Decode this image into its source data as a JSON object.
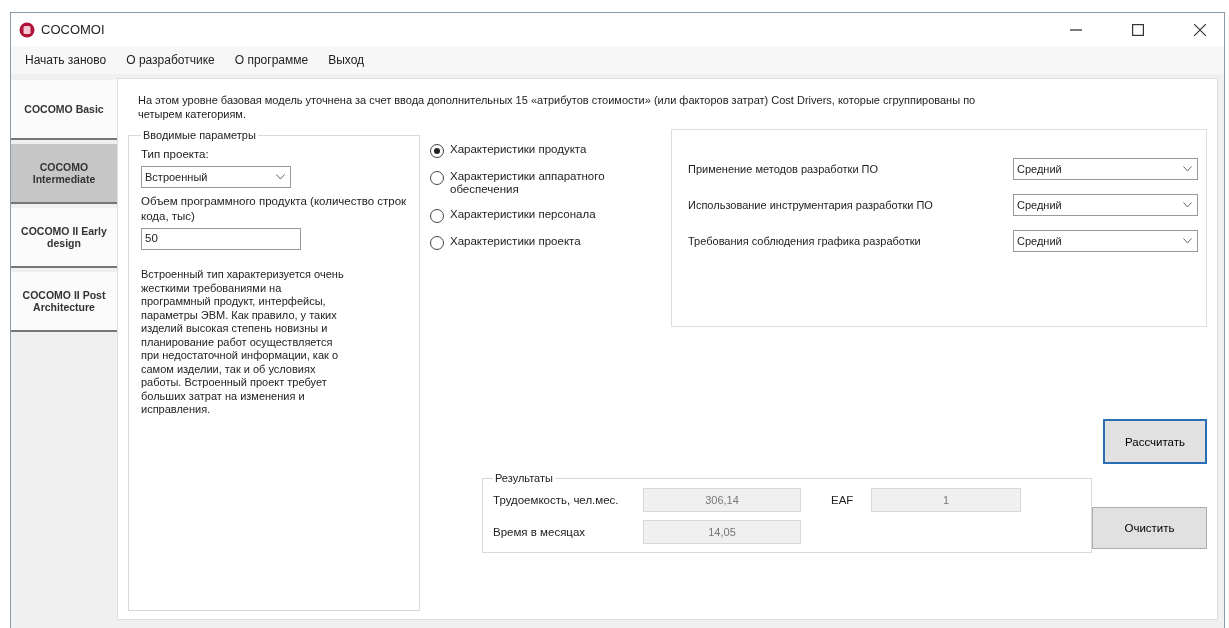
{
  "window": {
    "title": "COCOMOI"
  },
  "menu": [
    "Начать заново",
    "О разработчике",
    "О программе",
    "Выход"
  ],
  "tabs": [
    {
      "label": "COCOMO Basic",
      "selected": false
    },
    {
      "label": "COCOMO Intermediate",
      "selected": true
    },
    {
      "label": "COCOMO II Early design",
      "selected": false
    },
    {
      "label": "COCOMO II Post Architecture",
      "selected": false
    }
  ],
  "description": "На этом уровне базовая модель уточнена за счет ввода дополнительных 15 «атрибутов стоимости» (или факторов затрат) Cost Drivers, которые сгруппированы по четырем категориям.",
  "input_group": {
    "title": "Вводимые параметры",
    "project_type_label": "Тип проекта:",
    "project_type": "Встроенный",
    "size_label": "Объем программного продукта (количество строк кода, тыс)",
    "size": "50",
    "type_description": "Встроенный тип характеризуется очень жесткими требованиями на программный продукт, интерфейсы, параметры ЭВМ. Как правило, у таких изделий высокая степень новизны и планирование работ осуществляется при недостаточной информации, как о самом изделии, так и об условиях работы. Встроенный проект требует больших затрат на изменения и исправления."
  },
  "categories": [
    {
      "label": "Характеристики продукта",
      "selected": true
    },
    {
      "label": "Характеристики аппаратного обеспечения",
      "selected": false
    },
    {
      "label": "Характеристики персонала",
      "selected": false
    },
    {
      "label": "Характеристики проекта",
      "selected": false
    }
  ],
  "attributes": [
    {
      "label": "Применение методов разработки ПО",
      "value": "Средний"
    },
    {
      "label": "Использование инструментария разработки ПО",
      "value": "Средний"
    },
    {
      "label": "Требования соблюдения графика разработки",
      "value": "Средний"
    }
  ],
  "calculate_button": "Рассчитать",
  "results": {
    "title": "Результаты",
    "effort_label": "Трудоемкость, чел.мес.",
    "effort": "306,14",
    "eaf_label": "EAF",
    "eaf": "1",
    "time_label": "Время в месяцах",
    "time": "14,05"
  },
  "clear_button": "Очистить"
}
